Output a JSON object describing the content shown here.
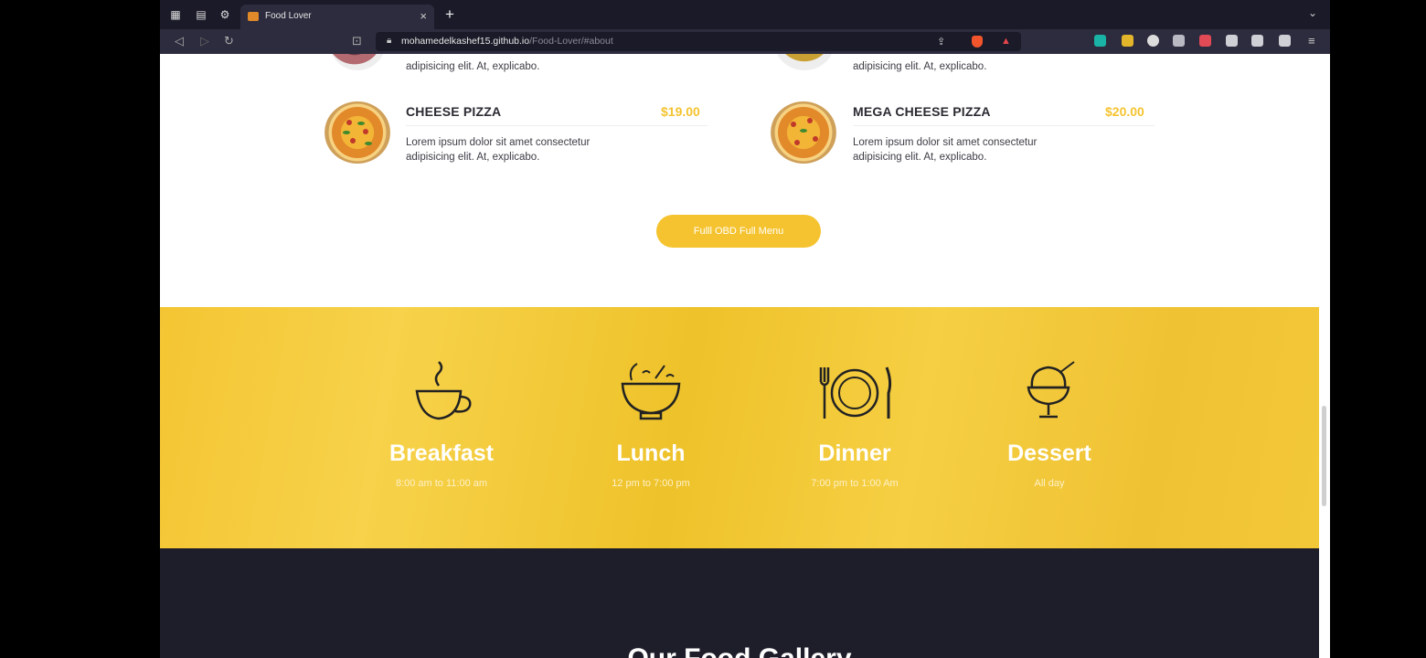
{
  "browser": {
    "tab_title": "Food Lover",
    "url_host": "mohamedelkashef15.github.io",
    "url_path": "/Food-Lover/#about"
  },
  "menu_items": [
    {
      "name": "CHEESE PIZZA",
      "price": "$19.00",
      "desc1": "Lorem ipsum dolor sit amet consectetur",
      "desc2": "adipisicing elit. At, explicabo."
    },
    {
      "name": "MEGA CHEESE PIZZA",
      "price": "$20.00",
      "desc1": "Lorem ipsum dolor sit amet consectetur",
      "desc2": "adipisicing elit. At, explicabo."
    }
  ],
  "partial_desc": "adipisicing elit. At, explicabo.",
  "view_menu_button": "Fulll OBD Full Menu",
  "hours": [
    {
      "title": "Breakfast",
      "time": "8:00 am to 11:00 am",
      "icon": "coffee-cup-icon"
    },
    {
      "title": "Lunch",
      "time": "12 pm to 7:00 pm",
      "icon": "soup-bowl-icon"
    },
    {
      "title": "Dinner",
      "time": "7:00 pm to 1:00 Am",
      "icon": "plate-cutlery-icon"
    },
    {
      "title": "Dessert",
      "time": "All day",
      "icon": "ice-cream-icon"
    }
  ],
  "gallery_title": "Our Food Gallery",
  "colors": {
    "accent": "#f5c32f",
    "dark": "#1e1d2a"
  }
}
